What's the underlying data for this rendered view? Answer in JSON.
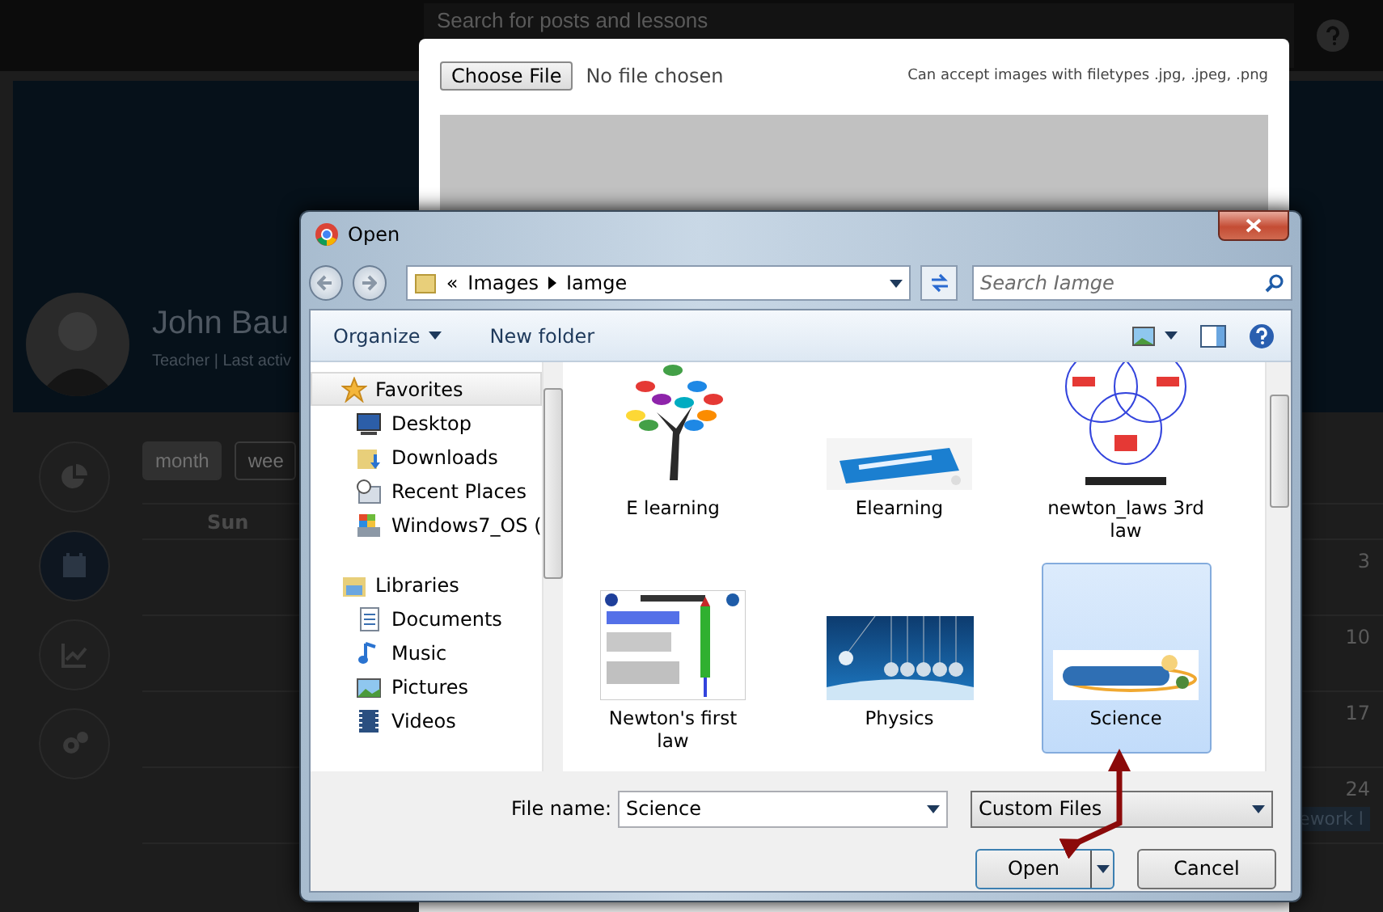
{
  "page": {
    "search_placeholder": "Search for posts and lessons",
    "profile": {
      "name": "John Bau",
      "subtitle": "Teacher | Last activ"
    },
    "side_nav": [
      {
        "kind": "chart",
        "selected": false
      },
      {
        "kind": "calendar",
        "selected": true
      },
      {
        "kind": "trend",
        "selected": false
      },
      {
        "kind": "settings",
        "selected": false
      }
    ],
    "view_buttons": [
      {
        "label": "month",
        "selected": true
      },
      {
        "label": "wee",
        "selected": false
      }
    ],
    "calendar": {
      "day_header": "Sun",
      "weeks": [
        {
          "day": "3"
        },
        {
          "day": "10"
        },
        {
          "day": "17"
        },
        {
          "day": "24",
          "event": "ework l"
        }
      ]
    }
  },
  "upload_modal": {
    "choose_button": "Choose File",
    "file_status": "No file chosen",
    "hint": "Can accept images with filetypes .jpg, .jpeg, .png"
  },
  "dialog": {
    "title": "Open",
    "overflow_mark": "«",
    "breadcrumb": [
      "Images",
      "Iamge"
    ],
    "search_placeholder": "Search Iamge",
    "toolbar": [
      {
        "label": "Organize",
        "menu": true
      },
      {
        "label": "New folder",
        "menu": false
      }
    ],
    "nav": [
      {
        "label": "Favorites",
        "kind": "star",
        "children": [
          {
            "label": "Desktop",
            "kind": "desktop"
          },
          {
            "label": "Downloads",
            "kind": "downloads"
          },
          {
            "label": "Recent Places",
            "kind": "recent"
          },
          {
            "label": "Windows7_OS (",
            "kind": "drive"
          }
        ]
      },
      {
        "label": "Libraries",
        "kind": "library",
        "children": [
          {
            "label": "Documents",
            "kind": "documents"
          },
          {
            "label": "Music",
            "kind": "music"
          },
          {
            "label": "Pictures",
            "kind": "pictures"
          },
          {
            "label": "Videos",
            "kind": "videos"
          }
        ]
      }
    ],
    "files": [
      {
        "name": "E learning",
        "kind": "tree",
        "selected": false
      },
      {
        "name": "Elearning",
        "kind": "puzzle",
        "selected": false
      },
      {
        "name": "newton_laws 3rd law",
        "kind": "venn",
        "selected": false
      },
      {
        "name": "Newton's first law",
        "kind": "poster",
        "selected": false
      },
      {
        "name": "Physics",
        "kind": "cradle",
        "selected": false
      },
      {
        "name": "Science",
        "kind": "logo",
        "selected": true
      }
    ],
    "file_name_label": "File name:",
    "file_name": "Science",
    "file_type": "Custom Files",
    "buttons": [
      {
        "label": "Open",
        "kind": "split"
      },
      {
        "label": "Cancel",
        "kind": "plain"
      }
    ]
  }
}
